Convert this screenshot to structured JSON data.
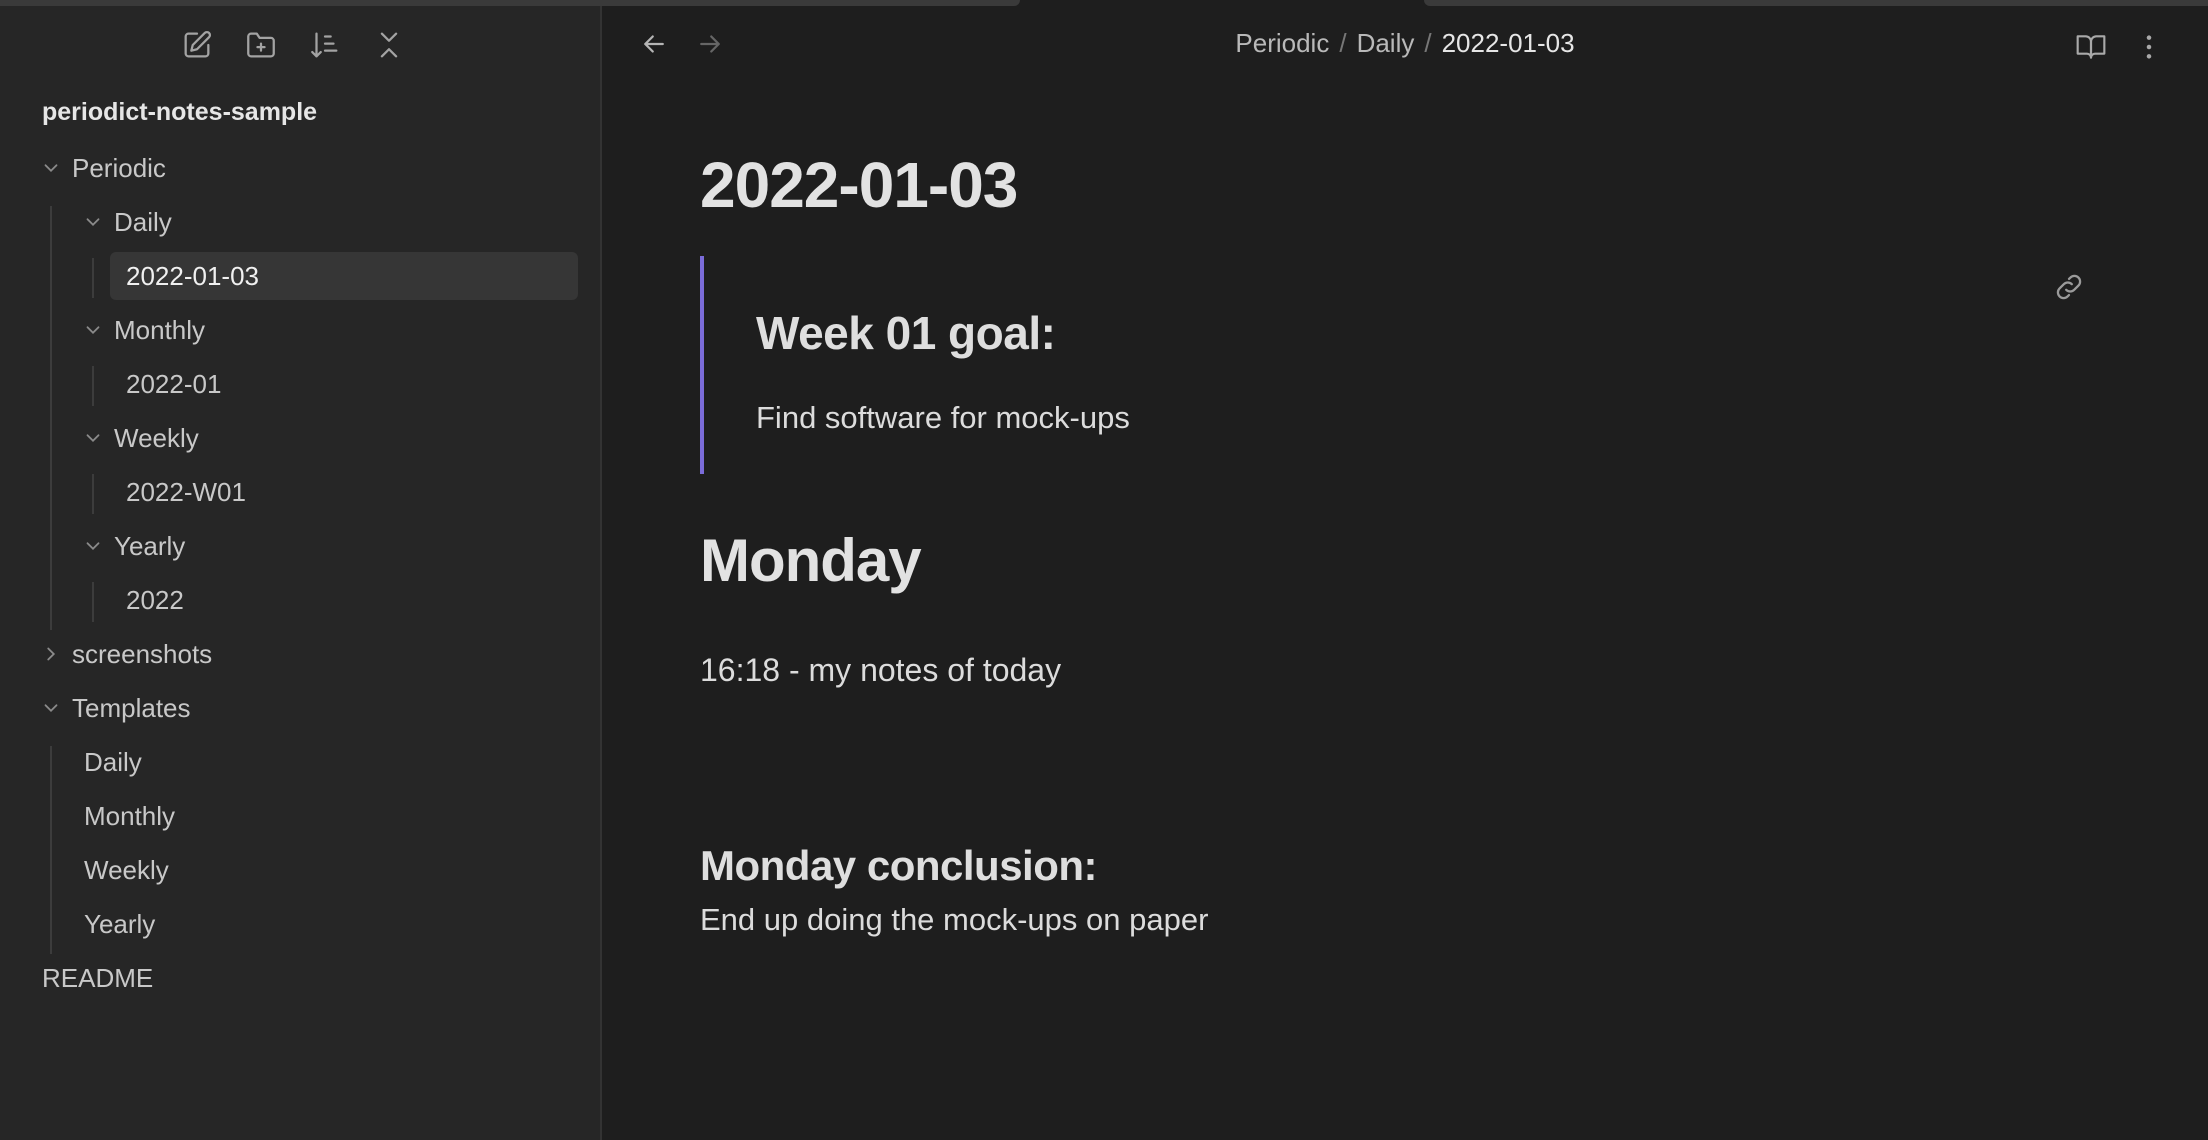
{
  "sidebar": {
    "toolbar": [
      {
        "name": "new-note-icon"
      },
      {
        "name": "new-folder-icon"
      },
      {
        "name": "sort-icon"
      },
      {
        "name": "collapse-all-icon"
      }
    ],
    "vault_name": "periodict-notes-sample",
    "tree": {
      "periodic": "Periodic",
      "daily": "Daily",
      "daily_note": "2022-01-03",
      "monthly": "Monthly",
      "monthly_note": "2022-01",
      "weekly": "Weekly",
      "weekly_note": "2022-W01",
      "yearly": "Yearly",
      "yearly_note": "2022",
      "screenshots": "screenshots",
      "templates": "Templates",
      "tpl_daily": "Daily",
      "tpl_monthly": "Monthly",
      "tpl_weekly": "Weekly",
      "tpl_yearly": "Yearly",
      "readme": "README"
    }
  },
  "header": {
    "breadcrumb": [
      "Periodic",
      "Daily",
      "2022-01-03"
    ],
    "separator": "/"
  },
  "content": {
    "title": "2022-01-03",
    "callout_title": "Week 01 goal:",
    "callout_text": "Find software for mock-ups",
    "heading_monday": "Monday",
    "notes_line": "16:18 - my notes of today",
    "conclusion_heading": "Monday conclusion:",
    "conclusion_text": "End up doing the mock-ups on paper"
  },
  "colors": {
    "background": "#1e1e1e",
    "sidebar": "#262626",
    "accent": "#7b6cd9"
  }
}
